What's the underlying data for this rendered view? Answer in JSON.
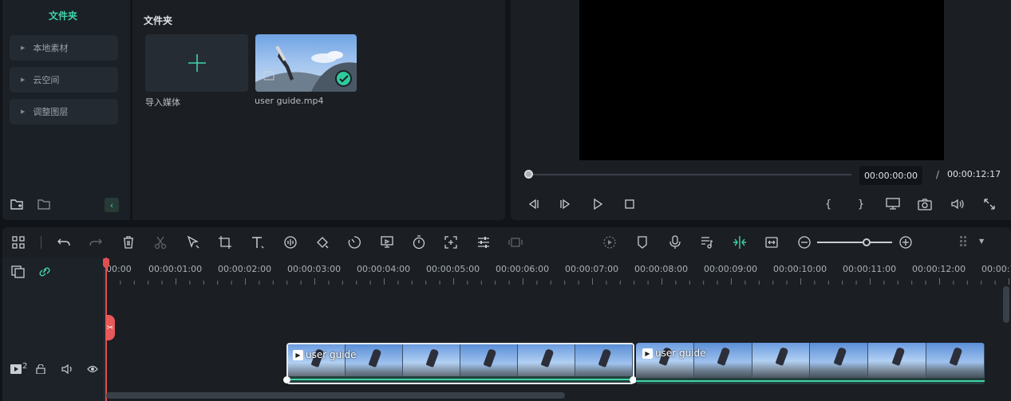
{
  "media_sidebar": {
    "title": "文件夹",
    "items": [
      {
        "label": "本地素材"
      },
      {
        "label": "云空间"
      },
      {
        "label": "调整图层"
      }
    ]
  },
  "media_browser": {
    "title": "文件夹",
    "import_label": "导入媒体",
    "media_items": [
      {
        "label": "user guide.mp4",
        "selected": true
      }
    ]
  },
  "preview": {
    "current_time": "00:00:00:00",
    "separator": "/",
    "total_time": "00:00:12:17",
    "progress_fraction": 0.0
  },
  "timeline": {
    "ruler_labels": [
      "00:00",
      "00:00:01:00",
      "00:00:02:00",
      "00:00:03:00",
      "00:00:04:00",
      "00:00:05:00",
      "00:00:06:00",
      "00:00:07:00",
      "00:00:08:00",
      "00:00:09:00",
      "00:00:10:00",
      "00:00:11:00",
      "00:00:12:00",
      "00:00:1"
    ],
    "track_number": "2",
    "clips": [
      {
        "title": "user guide"
      },
      {
        "title": "user guide"
      }
    ]
  },
  "colors": {
    "accent": "#3fd3aa",
    "playhead": "#e04f4f",
    "panel": "#1b1f24",
    "background": "#111418"
  }
}
